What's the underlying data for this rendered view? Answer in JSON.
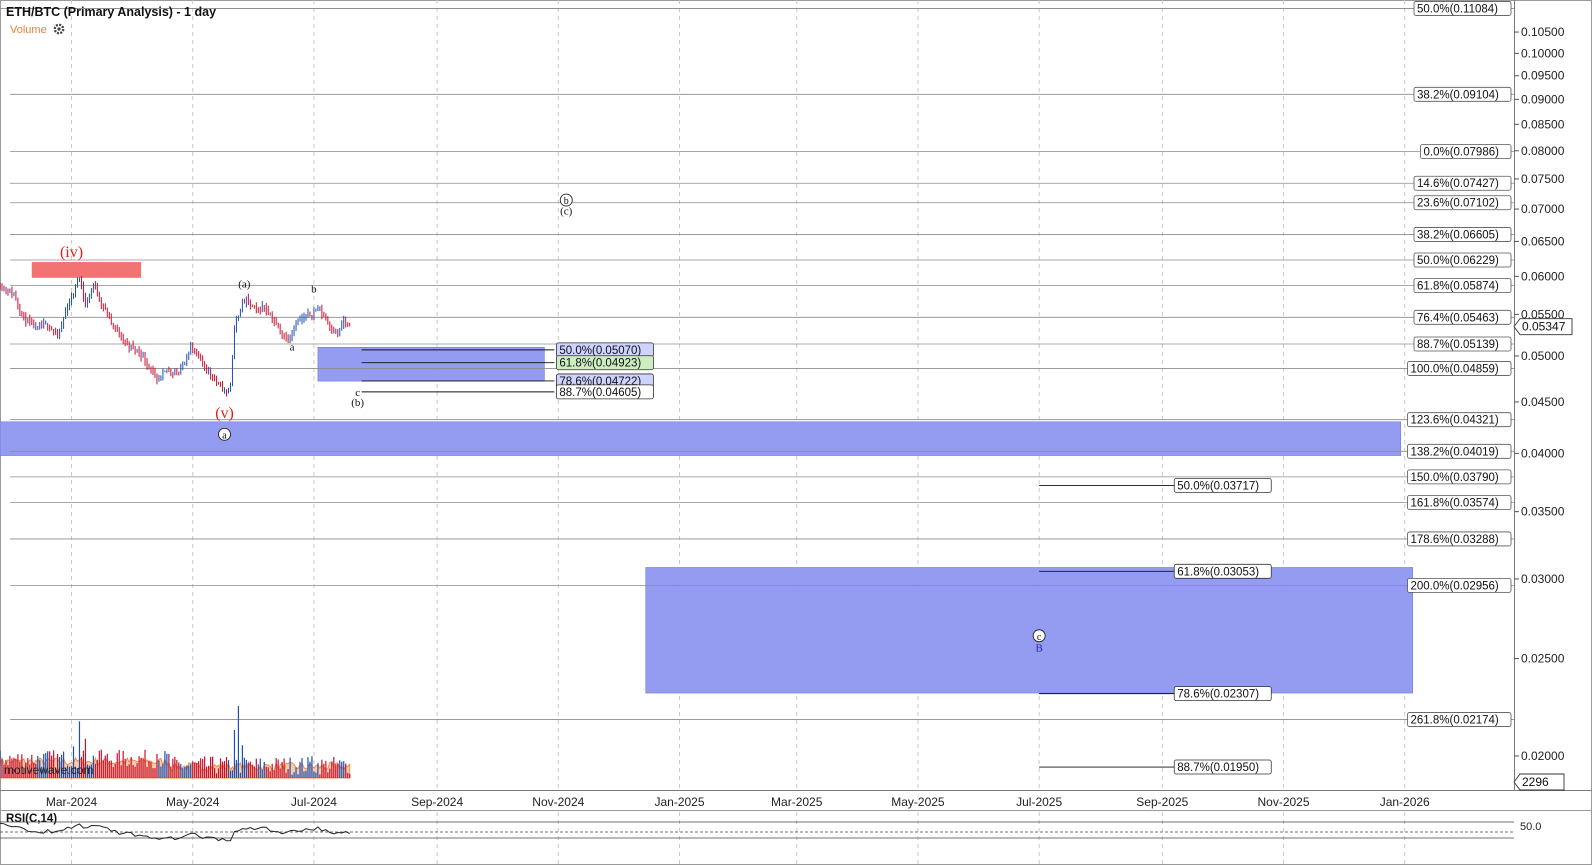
{
  "header": {
    "title": "ETH/BTC (Primary Analysis) - 1 day",
    "volume_label": "Volume",
    "gear_icon": "gear-icon"
  },
  "watermark": "motivewave.com",
  "colors": {
    "band": "#8f97f2",
    "band_edge": "#6a73e6",
    "red_zone": "#f06b6b",
    "red_label": "#e0201b",
    "volume_fill": "#f6c7a0",
    "volume_line": "#e8823a",
    "bar_red": "#c8102e",
    "bar_blue": "#1f4fb5",
    "level_line": "#8c8c8c"
  },
  "chart_data": {
    "type": "candlestick",
    "y_scale": "log",
    "y_range": [
      0.0185,
      0.113
    ],
    "x_range": [
      "2024-01-25",
      "2026-02-25"
    ],
    "y_ticks": [
      "0.10500",
      "0.10000",
      "0.09500",
      "0.09000",
      "0.08500",
      "0.08000",
      "0.07500",
      "0.07000",
      "0.06500",
      "0.06000",
      "0.05500",
      "0.05000",
      "0.04500",
      "0.04000",
      "0.03500",
      "0.03000",
      "0.02500",
      "0.02000"
    ],
    "x_ticks": [
      {
        "label": "Mar-2024",
        "date": "2024-03-01"
      },
      {
        "label": "May-2024",
        "date": "2024-05-01"
      },
      {
        "label": "Jul-2024",
        "date": "2024-07-01"
      },
      {
        "label": "Sep-2024",
        "date": "2024-09-01"
      },
      {
        "label": "Nov-2024",
        "date": "2024-11-01"
      },
      {
        "label": "Jan-2025",
        "date": "2025-01-01"
      },
      {
        "label": "Mar-2025",
        "date": "2025-03-01"
      },
      {
        "label": "May-2025",
        "date": "2025-05-01"
      },
      {
        "label": "Jul-2025",
        "date": "2025-07-01"
      },
      {
        "label": "Sep-2025",
        "date": "2025-09-01"
      },
      {
        "label": "Nov-2025",
        "date": "2025-11-01"
      },
      {
        "label": "Jan-2026",
        "date": "2026-01-01"
      }
    ],
    "last_price": "0.05347",
    "last_volume": "2296",
    "price_path": [
      {
        "date": "2024-01-25",
        "value": 0.0588
      },
      {
        "date": "2024-02-01",
        "value": 0.0575
      },
      {
        "date": "2024-02-06",
        "value": 0.0545
      },
      {
        "date": "2024-02-12",
        "value": 0.0532
      },
      {
        "date": "2024-02-18",
        "value": 0.0538
      },
      {
        "date": "2024-02-23",
        "value": 0.0522
      },
      {
        "date": "2024-02-28",
        "value": 0.056
      },
      {
        "date": "2024-03-03",
        "value": 0.0585
      },
      {
        "date": "2024-03-05",
        "value": 0.0602
      },
      {
        "date": "2024-03-08",
        "value": 0.056
      },
      {
        "date": "2024-03-12",
        "value": 0.059
      },
      {
        "date": "2024-03-16",
        "value": 0.0565
      },
      {
        "date": "2024-03-22",
        "value": 0.0535
      },
      {
        "date": "2024-03-28",
        "value": 0.0515
      },
      {
        "date": "2024-04-04",
        "value": 0.0505
      },
      {
        "date": "2024-04-10",
        "value": 0.0485
      },
      {
        "date": "2024-04-13",
        "value": 0.047
      },
      {
        "date": "2024-04-18",
        "value": 0.0485
      },
      {
        "date": "2024-04-24",
        "value": 0.048
      },
      {
        "date": "2024-04-30",
        "value": 0.051
      },
      {
        "date": "2024-05-05",
        "value": 0.0495
      },
      {
        "date": "2024-05-10",
        "value": 0.048
      },
      {
        "date": "2024-05-15",
        "value": 0.0465
      },
      {
        "date": "2024-05-18",
        "value": 0.046
      },
      {
        "date": "2024-05-20",
        "value": 0.047
      },
      {
        "date": "2024-05-22",
        "value": 0.053
      },
      {
        "date": "2024-05-25",
        "value": 0.056
      },
      {
        "date": "2024-05-28",
        "value": 0.0568
      },
      {
        "date": "2024-06-02",
        "value": 0.0555
      },
      {
        "date": "2024-06-06",
        "value": 0.056
      },
      {
        "date": "2024-06-10",
        "value": 0.0545
      },
      {
        "date": "2024-06-14",
        "value": 0.0528
      },
      {
        "date": "2024-06-18",
        "value": 0.052
      },
      {
        "date": "2024-06-22",
        "value": 0.054
      },
      {
        "date": "2024-06-26",
        "value": 0.0545
      },
      {
        "date": "2024-06-30",
        "value": 0.0552
      },
      {
        "date": "2024-07-03",
        "value": 0.0558
      },
      {
        "date": "2024-07-07",
        "value": 0.0545
      },
      {
        "date": "2024-07-10",
        "value": 0.0532
      },
      {
        "date": "2024-07-13",
        "value": 0.0525
      },
      {
        "date": "2024-07-16",
        "value": 0.0542
      },
      {
        "date": "2024-07-19",
        "value": 0.0534
      }
    ],
    "volume_spikes": [
      {
        "date": "2024-03-02",
        "value": 2900
      },
      {
        "date": "2024-03-05",
        "value": 5200
      },
      {
        "date": "2024-03-08",
        "value": 3600
      },
      {
        "date": "2024-03-15",
        "value": 2500
      },
      {
        "date": "2024-04-13",
        "value": 2200
      },
      {
        "date": "2024-05-22",
        "value": 4400
      },
      {
        "date": "2024-05-24",
        "value": 6600
      },
      {
        "date": "2024-05-26",
        "value": 3000
      },
      {
        "date": "2024-06-30",
        "value": 2000
      }
    ],
    "volume_baseline_scale": 6600,
    "horizontal_levels": [
      {
        "label": "50.0%(0.11084)",
        "value": 0.11084
      },
      {
        "label": "38.2%(0.09104)",
        "value": 0.09104
      },
      {
        "label": "0.0%(0.07986)",
        "value": 0.07986
      },
      {
        "label": "14.6%(0.07427)",
        "value": 0.07427
      },
      {
        "label": "23.6%(0.07102)",
        "value": 0.07102
      },
      {
        "label": "38.2%(0.06605)",
        "value": 0.06605
      },
      {
        "label": "50.0%(0.06229)",
        "value": 0.06229
      },
      {
        "label": "61.8%(0.05874)",
        "value": 0.05874
      },
      {
        "label": "76.4%(0.05463)",
        "value": 0.05463
      },
      {
        "label": "88.7%(0.05139)",
        "value": 0.05139
      },
      {
        "label": "100.0%(0.04859)",
        "value": 0.04859
      },
      {
        "label": "123.6%(0.04321)",
        "value": 0.04321
      },
      {
        "label": "138.2%(0.04019)",
        "value": 0.04019
      },
      {
        "label": "150.0%(0.03790)",
        "value": 0.0379
      },
      {
        "label": "161.8%(0.03574)",
        "value": 0.03574
      },
      {
        "label": "178.6%(0.03288)",
        "value": 0.03288
      },
      {
        "label": "200.0%(0.02956)",
        "value": 0.02956
      },
      {
        "label": "261.8%(0.02174)",
        "value": 0.02174
      }
    ],
    "near_fib_levels": [
      {
        "label": "50.0%(0.05070)",
        "value": 0.0507,
        "highlight": "#cfd3ff"
      },
      {
        "label": "61.8%(0.04923)",
        "value": 0.04923,
        "highlight": "#cdeec0"
      },
      {
        "label": "78.6%(0.04722)",
        "value": 0.04722,
        "highlight": "#cfd3ff"
      },
      {
        "label": "88.7%(0.04605)",
        "value": 0.04605,
        "highlight": "#ffffff"
      }
    ],
    "far_fib_levels": [
      {
        "label": "50.0%(0.03717)",
        "value": 0.03717
      },
      {
        "label": "61.8%(0.03053)",
        "value": 0.03053
      },
      {
        "label": "78.6%(0.02307)",
        "value": 0.02307
      },
      {
        "label": "88.7%(0.01950)",
        "value": 0.0195
      }
    ],
    "zones": [
      {
        "name": "iv-zone",
        "from": "2024-02-10",
        "to": "2024-04-05",
        "top": 0.062,
        "bottom": 0.0598
      },
      {
        "name": "near-target-zone",
        "from": "2024-07-03",
        "to": "2024-10-25",
        "top": 0.051,
        "bottom": 0.0472
      },
      {
        "name": "support-zone",
        "from": "2024-01-25",
        "to": "2025-12-30",
        "top": 0.043,
        "bottom": 0.0398
      },
      {
        "name": "deep-target-zone",
        "from": "2024-12-15",
        "to": "2026-01-05",
        "top": 0.0308,
        "bottom": 0.0231
      }
    ],
    "wave_labels": [
      {
        "text": "(iv)",
        "date": "2024-03-01",
        "value": 0.0627,
        "style": "red"
      },
      {
        "text": "(v)",
        "date": "2024-05-17",
        "value": 0.0434,
        "style": "red"
      },
      {
        "text": "a",
        "date": "2024-05-17",
        "value": 0.0414,
        "style": "circle"
      },
      {
        "text": "(a)",
        "date": "2024-05-27",
        "value": 0.0585,
        "style": "plain"
      },
      {
        "text": "b",
        "date": "2024-07-01",
        "value": 0.0578,
        "style": "plain"
      },
      {
        "text": "a",
        "date": "2024-06-20",
        "value": 0.0506,
        "style": "plain"
      },
      {
        "text": "c",
        "date": "2024-07-23",
        "value": 0.0456,
        "style": "plain"
      },
      {
        "text": "(b)",
        "date": "2024-07-23",
        "value": 0.0446,
        "style": "plain"
      },
      {
        "text": "b",
        "date": "2024-11-05",
        "value": 0.0708,
        "style": "circle"
      },
      {
        "text": "(c)",
        "date": "2024-11-05",
        "value": 0.0691,
        "style": "plain"
      },
      {
        "text": "c",
        "date": "2025-07-01",
        "value": 0.0261,
        "style": "circle"
      },
      {
        "text": "B",
        "date": "2025-07-01",
        "value": 0.0254,
        "style": "blue"
      }
    ],
    "rsi": {
      "label": "RSI(C,14)",
      "level_label": "50.0"
    }
  }
}
